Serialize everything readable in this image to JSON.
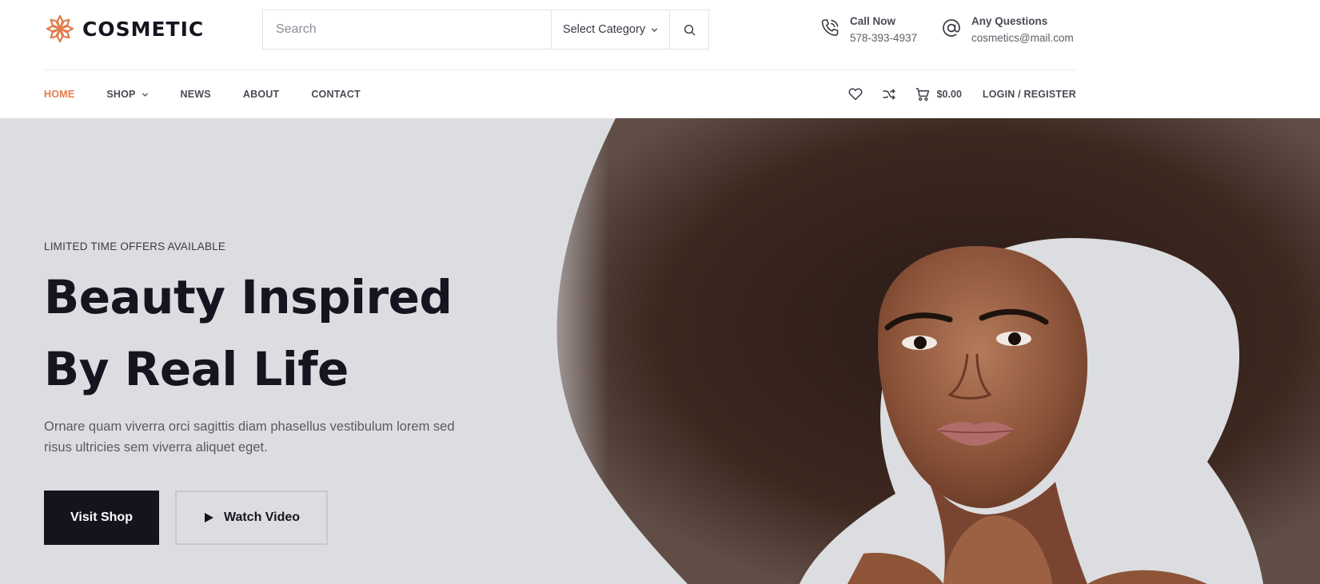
{
  "brand": {
    "name": "COSMETIC",
    "accent_color": "#e07c4b",
    "logo_icon": "flower-icon"
  },
  "search": {
    "placeholder": "Search",
    "category_label": "Select Category",
    "icon": "search-icon"
  },
  "contact": {
    "phone": {
      "title": "Call Now",
      "value": "578-393-4937",
      "icon": "phone-icon"
    },
    "email": {
      "title": "Any Questions",
      "value": "cosmetics@mail.com",
      "icon": "at-icon"
    }
  },
  "nav": {
    "items": [
      {
        "label": "HOME",
        "active": true
      },
      {
        "label": "SHOP",
        "has_dropdown": true
      },
      {
        "label": "NEWS"
      },
      {
        "label": "ABOUT"
      },
      {
        "label": "CONTACT"
      }
    ],
    "tools": {
      "wishlist_icon": "heart-icon",
      "compare_icon": "shuffle-icon",
      "cart_icon": "cart-icon",
      "cart_amount": "$0.00",
      "login_label": "LOGIN / REGISTER"
    }
  },
  "hero": {
    "eyebrow": "LIMITED TIME OFFERS AVAILABLE",
    "headline_line1": "Beauty Inspired",
    "headline_line2": "By Real Life",
    "description": "Ornare quam viverra orci sagittis diam phasellus vestibulum lorem sed risus ultricies sem viverra aliquet eget.",
    "primary_button": "Visit Shop",
    "secondary_button": "Watch Video",
    "background_color": "#dcdde0",
    "dark_color": "#14141f"
  }
}
